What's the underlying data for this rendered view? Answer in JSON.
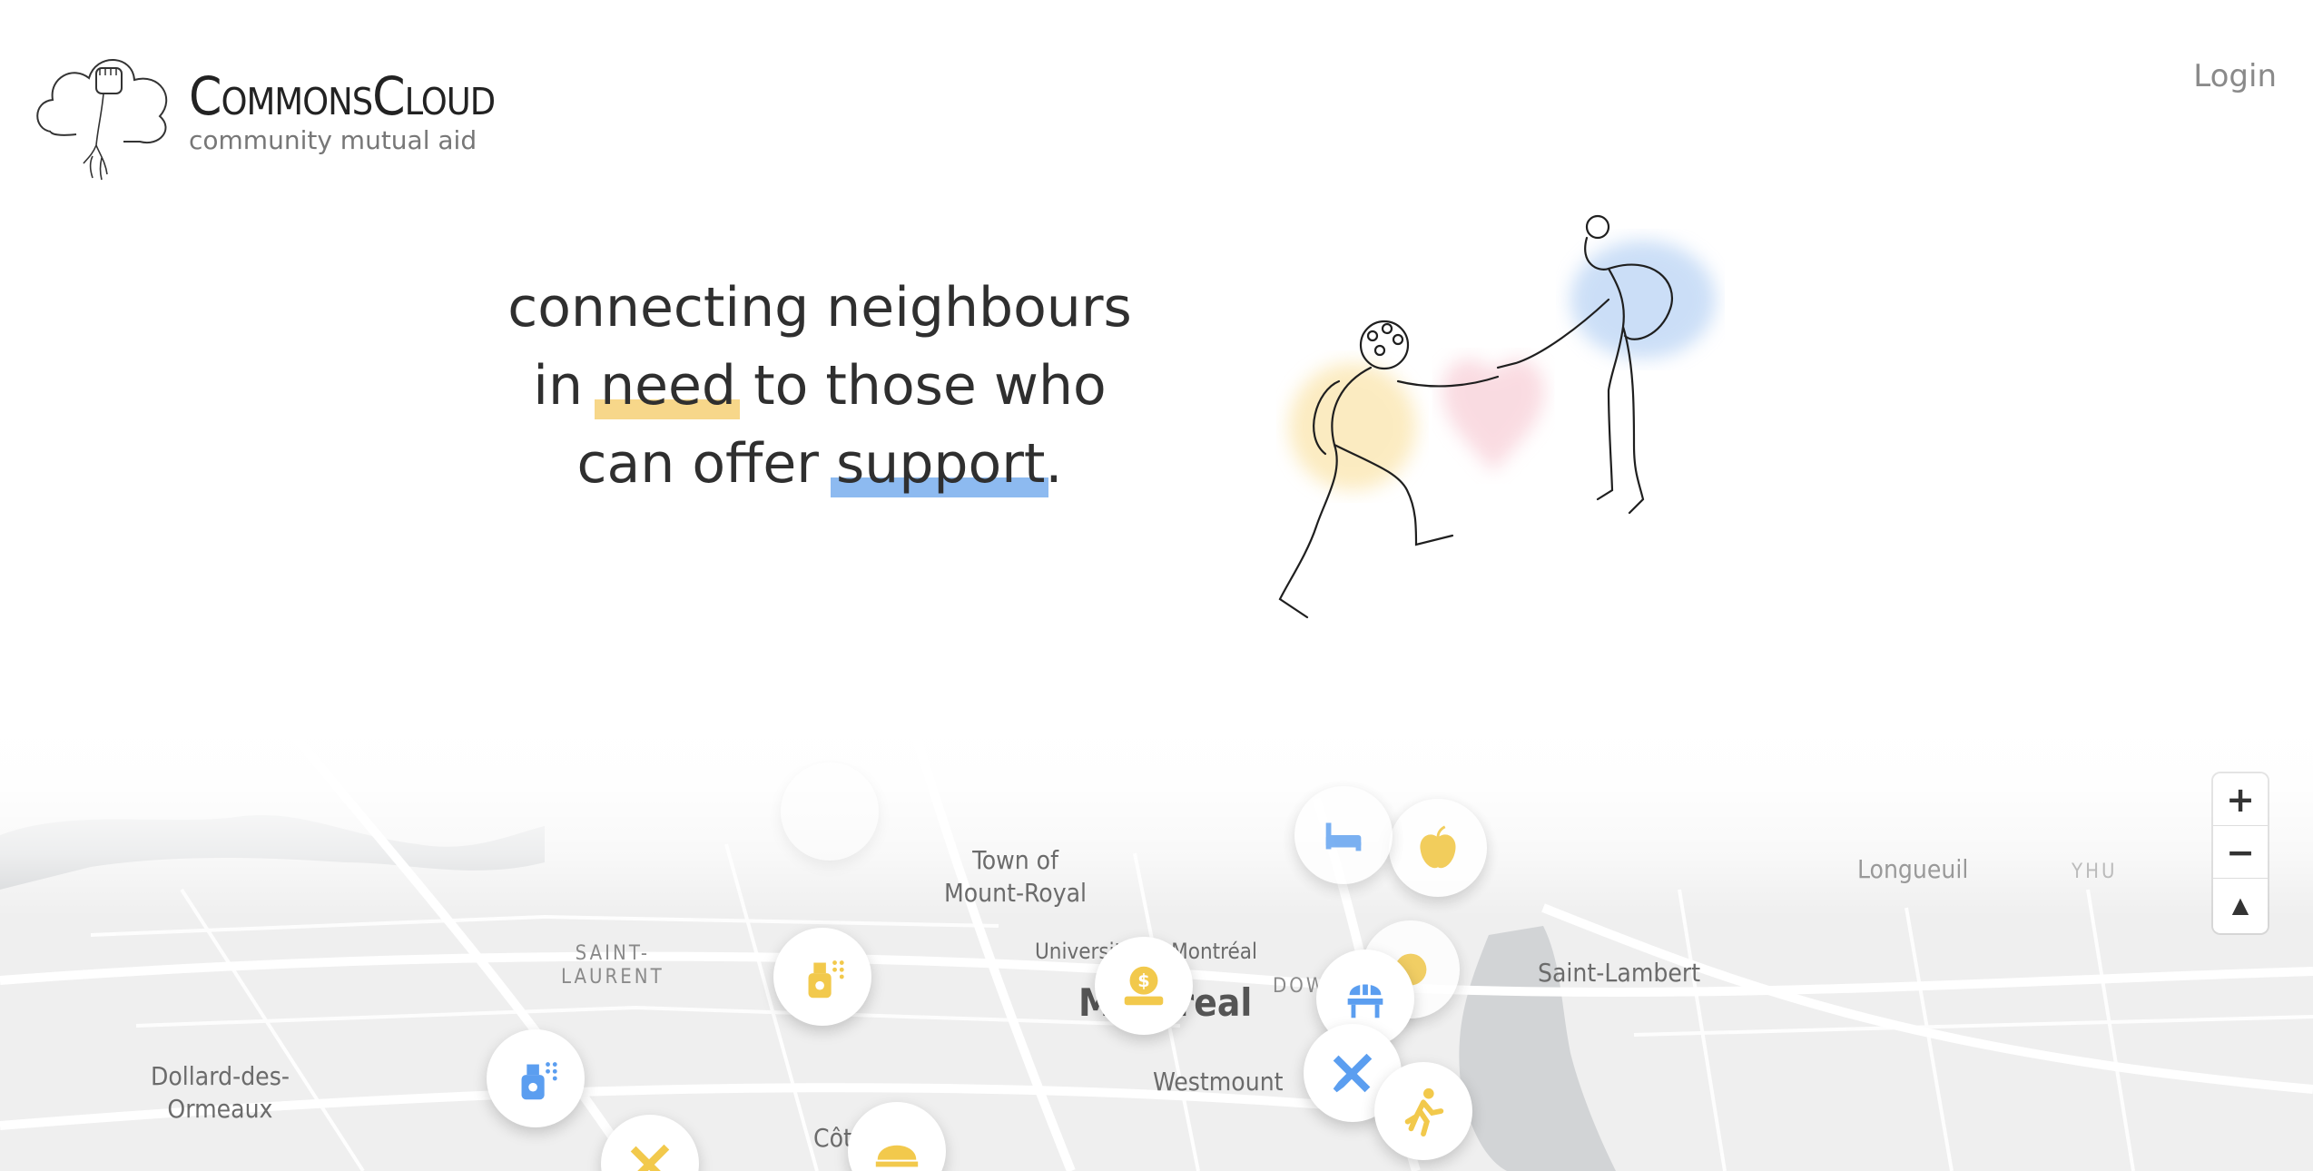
{
  "header": {
    "brand_name": "CommonsCloud",
    "tagline": "community mutual aid",
    "login_label": "Login"
  },
  "hero": {
    "line1": "connecting neighbours",
    "line2_pre": "in ",
    "need_word": "need",
    "line2_post": " to those who",
    "line3_pre": "can offer ",
    "support_word": "support",
    "line3_post": "."
  },
  "colors": {
    "need_highlight": "#f7d78a",
    "support_highlight": "#8dbaf0",
    "pin_yellow": "#f2c94c",
    "pin_blue": "#5b9ef0"
  },
  "map": {
    "places": {
      "town_of_mount_royal_1": "Town of",
      "town_of_mount_royal_2": "Mount-Royal",
      "saint_laurent_1": "SAINT-",
      "saint_laurent_2": "LAURENT",
      "universite": "Université de Montréal",
      "montreal": "Montreal",
      "downtown": "DOWNTOWN",
      "dollard_1": "Dollard-des-",
      "dollard_2": "Ormeaux",
      "westmount": "Westmount",
      "saint_lambert": "Saint-Lambert",
      "longueuil": "Longueuil",
      "yhu": "YHU",
      "cote": "Côte"
    },
    "pins": [
      {
        "icon": "spray-bottle-icon",
        "color": "yellow"
      },
      {
        "icon": "spray-bottle-icon",
        "color": "blue"
      },
      {
        "icon": "money-donation-icon",
        "color": "yellow"
      },
      {
        "icon": "bench-icon",
        "color": "blue"
      },
      {
        "icon": "tools-icon",
        "color": "blue"
      },
      {
        "icon": "running-person-icon",
        "color": "yellow"
      },
      {
        "icon": "apple-icon",
        "color": "yellow"
      },
      {
        "icon": "bed-icon",
        "color": "blue"
      },
      {
        "icon": "tools-icon",
        "color": "yellow"
      },
      {
        "icon": "food-icon",
        "color": "yellow"
      }
    ],
    "controls": {
      "zoom_in": "+",
      "zoom_out": "−",
      "compass": "▲"
    }
  }
}
